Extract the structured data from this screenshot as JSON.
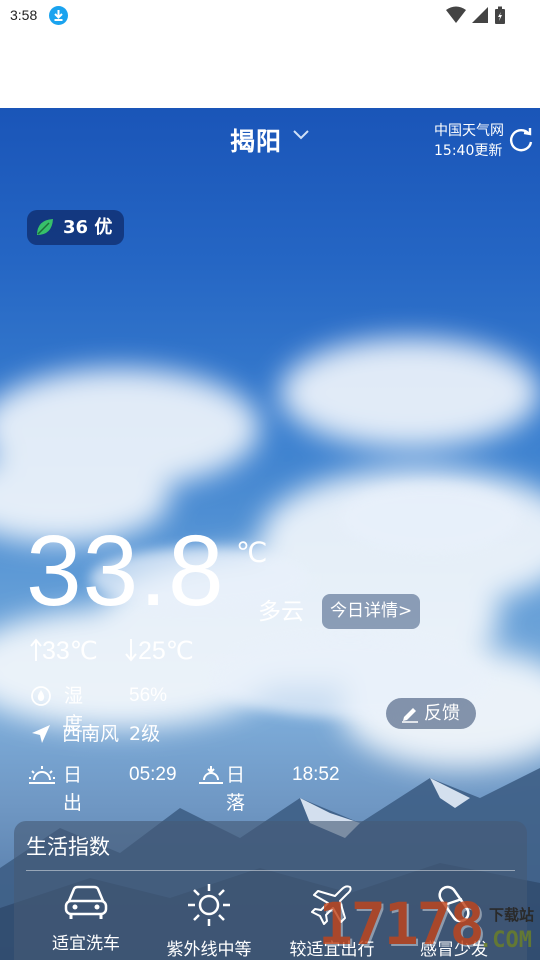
{
  "status_bar": {
    "time": "3:58"
  },
  "header": {
    "city": "揭阳",
    "source": "中国天气网",
    "updated": "15:40更新"
  },
  "aqi": {
    "value": "36",
    "level": "优"
  },
  "current": {
    "temperature": "33.8",
    "unit": "℃",
    "condition": "多云",
    "detail_button": "今日详情>",
    "high": "33℃",
    "low": "25℃"
  },
  "details": {
    "humidity_label": "湿度",
    "humidity_value": "56%",
    "wind_dir": "西南风",
    "wind_level": "2级",
    "sunrise_label": "日出",
    "sunrise_time": "05:29",
    "sunset_label": "日落",
    "sunset_time": "18:52"
  },
  "feedback_label": "反馈",
  "life_index": {
    "title": "生活指数",
    "items": [
      {
        "label": "适宜洗车",
        "icon": "car-icon"
      },
      {
        "label": "紫外线中等",
        "icon": "sun-icon"
      },
      {
        "label": "较适宜出行",
        "icon": "airplane-icon"
      },
      {
        "label": "感冒少发",
        "icon": "pill-icon"
      }
    ]
  },
  "watermark": {
    "text": "17178",
    "sub": "下载站",
    "domain": ".COM"
  },
  "colors": {
    "sky_top": "#1a55b8",
    "aqi_good": "#37c06a"
  }
}
